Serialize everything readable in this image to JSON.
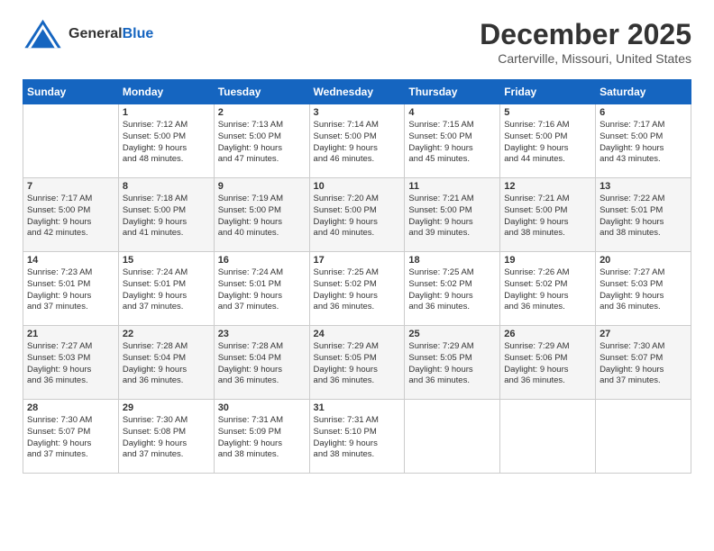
{
  "header": {
    "logo_general": "General",
    "logo_blue": "Blue",
    "title": "December 2025",
    "location": "Carterville, Missouri, United States"
  },
  "days_of_week": [
    "Sunday",
    "Monday",
    "Tuesday",
    "Wednesday",
    "Thursday",
    "Friday",
    "Saturday"
  ],
  "weeks": [
    [
      {
        "day": "",
        "info": ""
      },
      {
        "day": "1",
        "info": "Sunrise: 7:12 AM\nSunset: 5:00 PM\nDaylight: 9 hours\nand 48 minutes."
      },
      {
        "day": "2",
        "info": "Sunrise: 7:13 AM\nSunset: 5:00 PM\nDaylight: 9 hours\nand 47 minutes."
      },
      {
        "day": "3",
        "info": "Sunrise: 7:14 AM\nSunset: 5:00 PM\nDaylight: 9 hours\nand 46 minutes."
      },
      {
        "day": "4",
        "info": "Sunrise: 7:15 AM\nSunset: 5:00 PM\nDaylight: 9 hours\nand 45 minutes."
      },
      {
        "day": "5",
        "info": "Sunrise: 7:16 AM\nSunset: 5:00 PM\nDaylight: 9 hours\nand 44 minutes."
      },
      {
        "day": "6",
        "info": "Sunrise: 7:17 AM\nSunset: 5:00 PM\nDaylight: 9 hours\nand 43 minutes."
      }
    ],
    [
      {
        "day": "7",
        "info": "Sunrise: 7:17 AM\nSunset: 5:00 PM\nDaylight: 9 hours\nand 42 minutes."
      },
      {
        "day": "8",
        "info": "Sunrise: 7:18 AM\nSunset: 5:00 PM\nDaylight: 9 hours\nand 41 minutes."
      },
      {
        "day": "9",
        "info": "Sunrise: 7:19 AM\nSunset: 5:00 PM\nDaylight: 9 hours\nand 40 minutes."
      },
      {
        "day": "10",
        "info": "Sunrise: 7:20 AM\nSunset: 5:00 PM\nDaylight: 9 hours\nand 40 minutes."
      },
      {
        "day": "11",
        "info": "Sunrise: 7:21 AM\nSunset: 5:00 PM\nDaylight: 9 hours\nand 39 minutes."
      },
      {
        "day": "12",
        "info": "Sunrise: 7:21 AM\nSunset: 5:00 PM\nDaylight: 9 hours\nand 38 minutes."
      },
      {
        "day": "13",
        "info": "Sunrise: 7:22 AM\nSunset: 5:01 PM\nDaylight: 9 hours\nand 38 minutes."
      }
    ],
    [
      {
        "day": "14",
        "info": "Sunrise: 7:23 AM\nSunset: 5:01 PM\nDaylight: 9 hours\nand 37 minutes."
      },
      {
        "day": "15",
        "info": "Sunrise: 7:24 AM\nSunset: 5:01 PM\nDaylight: 9 hours\nand 37 minutes."
      },
      {
        "day": "16",
        "info": "Sunrise: 7:24 AM\nSunset: 5:01 PM\nDaylight: 9 hours\nand 37 minutes."
      },
      {
        "day": "17",
        "info": "Sunrise: 7:25 AM\nSunset: 5:02 PM\nDaylight: 9 hours\nand 36 minutes."
      },
      {
        "day": "18",
        "info": "Sunrise: 7:25 AM\nSunset: 5:02 PM\nDaylight: 9 hours\nand 36 minutes."
      },
      {
        "day": "19",
        "info": "Sunrise: 7:26 AM\nSunset: 5:02 PM\nDaylight: 9 hours\nand 36 minutes."
      },
      {
        "day": "20",
        "info": "Sunrise: 7:27 AM\nSunset: 5:03 PM\nDaylight: 9 hours\nand 36 minutes."
      }
    ],
    [
      {
        "day": "21",
        "info": "Sunrise: 7:27 AM\nSunset: 5:03 PM\nDaylight: 9 hours\nand 36 minutes."
      },
      {
        "day": "22",
        "info": "Sunrise: 7:28 AM\nSunset: 5:04 PM\nDaylight: 9 hours\nand 36 minutes."
      },
      {
        "day": "23",
        "info": "Sunrise: 7:28 AM\nSunset: 5:04 PM\nDaylight: 9 hours\nand 36 minutes."
      },
      {
        "day": "24",
        "info": "Sunrise: 7:29 AM\nSunset: 5:05 PM\nDaylight: 9 hours\nand 36 minutes."
      },
      {
        "day": "25",
        "info": "Sunrise: 7:29 AM\nSunset: 5:05 PM\nDaylight: 9 hours\nand 36 minutes."
      },
      {
        "day": "26",
        "info": "Sunrise: 7:29 AM\nSunset: 5:06 PM\nDaylight: 9 hours\nand 36 minutes."
      },
      {
        "day": "27",
        "info": "Sunrise: 7:30 AM\nSunset: 5:07 PM\nDaylight: 9 hours\nand 37 minutes."
      }
    ],
    [
      {
        "day": "28",
        "info": "Sunrise: 7:30 AM\nSunset: 5:07 PM\nDaylight: 9 hours\nand 37 minutes."
      },
      {
        "day": "29",
        "info": "Sunrise: 7:30 AM\nSunset: 5:08 PM\nDaylight: 9 hours\nand 37 minutes."
      },
      {
        "day": "30",
        "info": "Sunrise: 7:31 AM\nSunset: 5:09 PM\nDaylight: 9 hours\nand 38 minutes."
      },
      {
        "day": "31",
        "info": "Sunrise: 7:31 AM\nSunset: 5:10 PM\nDaylight: 9 hours\nand 38 minutes."
      },
      {
        "day": "",
        "info": ""
      },
      {
        "day": "",
        "info": ""
      },
      {
        "day": "",
        "info": ""
      }
    ]
  ]
}
